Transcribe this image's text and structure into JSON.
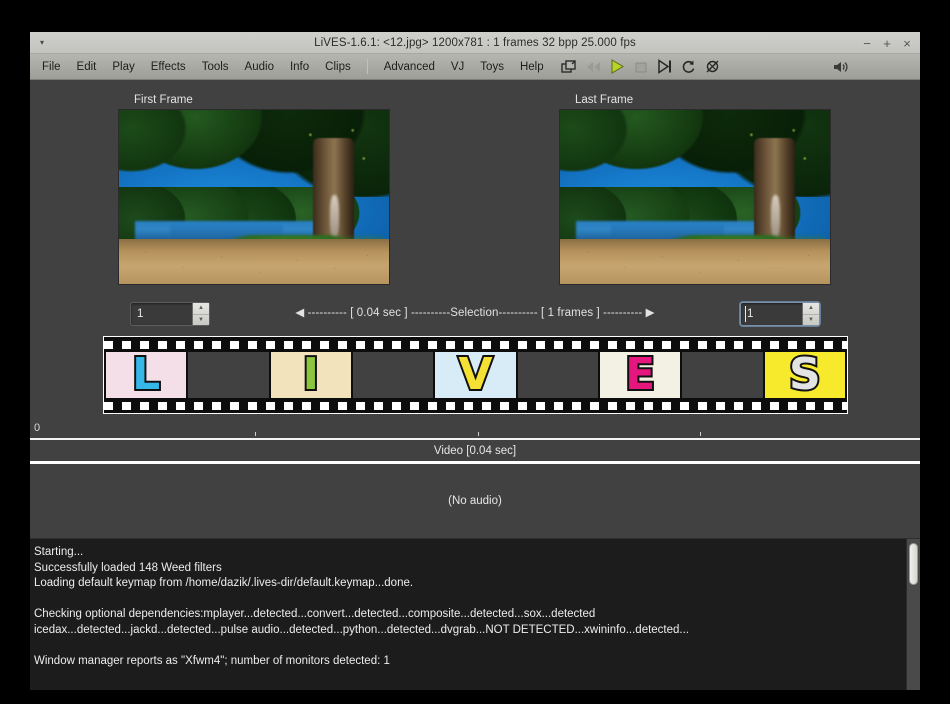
{
  "window": {
    "title": "LiVES-1.6.1: <12.jpg> 1200x781 : 1 frames 32 bpp 25.000 fps",
    "menu_glyph": "▾",
    "minimize": "−",
    "maximize": "+",
    "close": "×"
  },
  "menubar": {
    "items": [
      {
        "label": "File"
      },
      {
        "label": "Edit"
      },
      {
        "label": "Play"
      },
      {
        "label": "Effects"
      },
      {
        "label": "Tools"
      },
      {
        "label": "Audio"
      },
      {
        "label": "Info"
      },
      {
        "label": "Clips"
      }
    ],
    "items_right": [
      {
        "label": "Advanced"
      },
      {
        "label": "VJ"
      },
      {
        "label": "Toys"
      },
      {
        "label": "Help"
      }
    ],
    "toolbar_icons": [
      {
        "name": "separate-windows-icon",
        "enabled": true
      },
      {
        "name": "rewind-icon",
        "enabled": false
      },
      {
        "name": "play-icon",
        "enabled": true
      },
      {
        "name": "stop-icon",
        "enabled": false
      },
      {
        "name": "play-selection-icon",
        "enabled": true
      },
      {
        "name": "loop-icon",
        "enabled": true
      },
      {
        "name": "mute-audio-icon",
        "enabled": true
      }
    ],
    "volume_icon": "volume-icon"
  },
  "frames": {
    "first": {
      "label": "First Frame",
      "spin_value": "1",
      "focused": false
    },
    "last": {
      "label": "Last Frame",
      "spin_value": "1",
      "focused": true
    }
  },
  "selection": {
    "text": "◀ ---------- [ 0.04 sec ] ----------Selection---------- [ 1 frames ] ---------- ▶",
    "duration": "0.04 sec",
    "frames": "1 frames",
    "label": "Selection"
  },
  "filmstrip": {
    "cells": [
      {
        "letter": "L",
        "color": "#35b8e8",
        "bg": "#f4dfe9",
        "blank": false
      },
      {
        "letter": "",
        "color": "",
        "bg": "",
        "blank": true
      },
      {
        "letter": "I",
        "color": "#8cc63f",
        "bg": "#f3e3bd",
        "blank": false
      },
      {
        "letter": "",
        "color": "",
        "bg": "",
        "blank": true
      },
      {
        "letter": "V",
        "color": "#f5e034",
        "bg": "#d8ecf7",
        "blank": false
      },
      {
        "letter": "",
        "color": "",
        "bg": "",
        "blank": true
      },
      {
        "letter": "E",
        "color": "#e5177f",
        "bg": "#f3f0e4",
        "blank": false
      },
      {
        "letter": "",
        "color": "",
        "bg": "",
        "blank": true
      },
      {
        "letter": "S",
        "color": "#e3e3e3",
        "bg": "#f7ea2c",
        "blank": false
      }
    ]
  },
  "timeline": {
    "zero_label": "0",
    "video_label": "Video [0.04 sec]",
    "audio_label": "(No audio)"
  },
  "console": {
    "lines": [
      "Starting...",
      "Successfully loaded 148 Weed filters",
      "Loading default keymap from /home/dazik/.lives-dir/default.keymap...done.",
      "",
      "Checking optional dependencies:mplayer...detected...convert...detected...composite...detected...sox...detected",
      "icedax...detected...jackd...detected...pulse audio...detected...python...detected...dvgrab...NOT DETECTED...xwininfo...detected...",
      "",
      "Window manager reports as \"Xfwm4\"; number of monitors detected: 1"
    ]
  },
  "colors": {
    "window_bg": "#414141",
    "titlebar": "#c8c8c4",
    "menubar": "#a9a9a4",
    "console_bg": "#1c1c1c",
    "play_green": "#9acd32",
    "text": "#e6e6e6"
  }
}
